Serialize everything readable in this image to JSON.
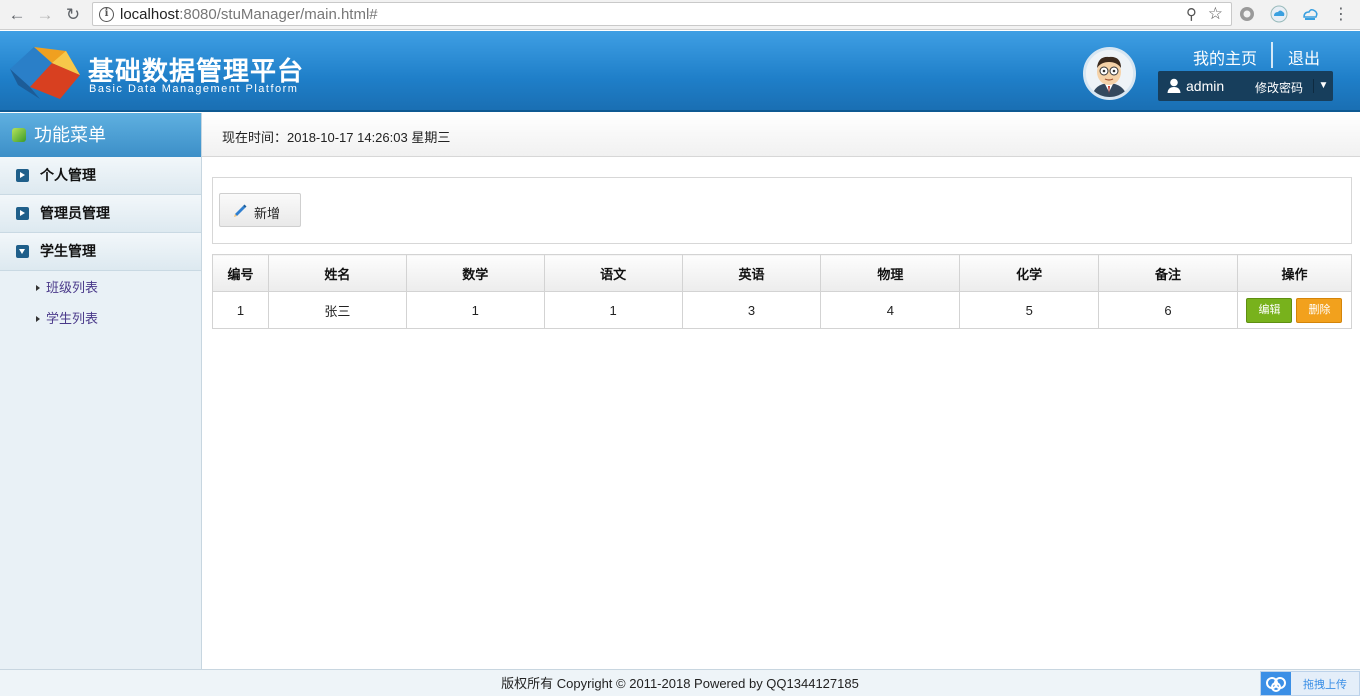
{
  "browser": {
    "url_host": "localhost",
    "url_rest": ":8080/stuManager/main.html#"
  },
  "header": {
    "title": "基础数据管理平台",
    "subtitle": "Basic Data Management Platform",
    "home_link": "我的主页",
    "logout_link": "退出",
    "username": "admin",
    "change_password": "修改密码",
    "colors": {
      "header_top": "#3f9fe4",
      "header_bottom": "#1a6fb3",
      "user_box": "#173e5c"
    }
  },
  "sidebar": {
    "title": "功能菜单",
    "items": [
      {
        "label": "个人管理",
        "expanded": false
      },
      {
        "label": "管理员管理",
        "expanded": false
      },
      {
        "label": "学生管理",
        "expanded": true,
        "children": [
          "班级列表",
          "学生列表"
        ]
      }
    ]
  },
  "main": {
    "time_text": "现在时间：2018-10-17 14:26:03 星期三",
    "add_button": "新增",
    "table": {
      "headers": [
        "编号",
        "姓名",
        "数学",
        "语文",
        "英语",
        "物理",
        "化学",
        "备注",
        "操作"
      ],
      "rows": [
        {
          "id": "1",
          "name": "张三",
          "math": "1",
          "chinese": "1",
          "english": "3",
          "physics": "4",
          "chemistry": "5",
          "remark": "6"
        }
      ],
      "edit_label": "编辑",
      "delete_label": "删除",
      "colors": {
        "edit": "#78b21c",
        "delete": "#f2a11d"
      }
    }
  },
  "footer": {
    "copyright": "版权所有 Copyright © 2011-2018 Powered by QQ1344127185",
    "upload_label": "拖拽上传"
  }
}
